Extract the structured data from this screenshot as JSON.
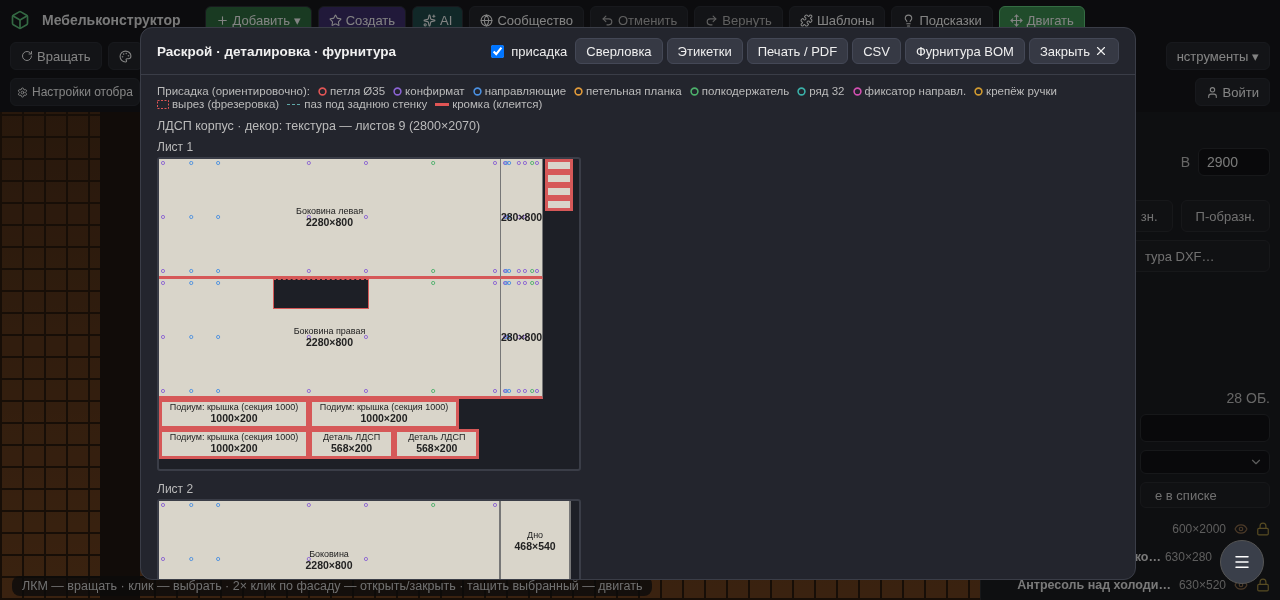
{
  "app": {
    "title": "Мебельконструктор",
    "toolbar": [
      {
        "label": "Добавить ▾",
        "kind": "green",
        "disabled": false,
        "selected": false
      },
      {
        "label": "Создать",
        "kind": "purple",
        "disabled": false,
        "selected": false
      },
      {
        "label": "AI",
        "kind": "teal",
        "disabled": false,
        "selected": false
      },
      {
        "label": "Сообщество",
        "kind": "plain",
        "disabled": false,
        "selected": false
      },
      {
        "label": "Отменить",
        "kind": "plain",
        "disabled": true,
        "selected": false
      },
      {
        "label": "Вернуть",
        "kind": "plain",
        "disabled": true,
        "selected": false
      },
      {
        "label": "Шаблоны",
        "kind": "plain",
        "disabled": false,
        "selected": false
      },
      {
        "label": "Подсказки",
        "kind": "plain",
        "disabled": false,
        "selected": false
      },
      {
        "label": "Двигать",
        "kind": "green",
        "disabled": false,
        "selected": true
      }
    ],
    "mode_button": {
      "label": "Вращать",
      "selected": false
    },
    "tools_menu": "нструменты ▾",
    "settings_button": "Настройки отобра",
    "login_button": "Войти",
    "side_panel": {
      "height_label": "В",
      "height_value": "2900",
      "shape_buttons": [
        "зн.",
        "П-образн."
      ],
      "export_button": "тура DXF…",
      "count": "28 ОБ.",
      "filter_hint": "е в списке",
      "items": [
        {
          "size": "600×2000"
        },
        {
          "name": "ко…",
          "size": "630×280"
        },
        {
          "name": "Антресоль над холоди…",
          "size": "630×520"
        }
      ]
    },
    "hint": "ЛКМ — вращать · клик — выбрать · 2× клик по фасаду — открыть/закрыть · тащить выбранный — двигать"
  },
  "dialog": {
    "title": "Раскрой · деталировка · фурнитура",
    "drilling_toggle": {
      "label": "присадка",
      "checked": true
    },
    "buttons": [
      {
        "label": "Сверловка",
        "kind": "plain"
      },
      {
        "label": "Этикетки",
        "kind": "plain"
      },
      {
        "label": "Печать / PDF",
        "kind": "plain"
      },
      {
        "label": "CSV",
        "kind": "plain"
      },
      {
        "label": "Фурнитура BOM",
        "kind": "plain"
      },
      {
        "label": "Закрыть",
        "kind": "close"
      }
    ],
    "legend": {
      "title": "Присадка (ориентировочно):",
      "items": [
        {
          "label": "петля Ø35",
          "kind": "hole",
          "color": "#e05555"
        },
        {
          "label": "конфирмат",
          "kind": "hole",
          "color": "#8a63d2"
        },
        {
          "label": "направляющие",
          "kind": "hole",
          "color": "#4a8fe0"
        },
        {
          "label": "петельная планка",
          "kind": "hole",
          "color": "#e09a3a"
        },
        {
          "label": "полкодержатель",
          "kind": "hole",
          "color": "#4caf6a"
        },
        {
          "label": "ряд 32",
          "kind": "hole",
          "color": "#3ab0a8"
        },
        {
          "label": "фиксатор направл.",
          "kind": "hole",
          "color": "#d04fb0"
        },
        {
          "label": "крепёж ручки",
          "kind": "hole",
          "color": "#d09a30"
        },
        {
          "label": "вырез (фрезеровка)",
          "kind": "cutout",
          "color": "#e05555"
        },
        {
          "label": "паз под заднюю стенку",
          "kind": "groove",
          "color": "#5fa8a8"
        },
        {
          "label": "кромка (клеится)",
          "kind": "edge",
          "color": "#e05555"
        }
      ]
    },
    "material": "ЛДСП корпус · декор: текстура — листов 9 (2800×2070)",
    "sheets": [
      {
        "title": "Лист 1",
        "parts": [
          {
            "name": "Боковина левая",
            "size": "2280×800",
            "kind": "side"
          },
          {
            "size": "280×800",
            "kind": "side"
          },
          {
            "kind": "banded"
          },
          {
            "kind": "banded"
          },
          {
            "kind": "banded"
          },
          {
            "kind": "banded"
          },
          {
            "name": "Боковина правая",
            "size": "2280×800",
            "kind": "notched"
          },
          {
            "size": "280×800",
            "kind": "side"
          },
          {
            "name": "Подиум: крышка (секция 1000)",
            "size": "1000×200",
            "kind": "banded"
          },
          {
            "name": "Подиум: крышка (секция 1000)",
            "size": "1000×200",
            "kind": "banded"
          },
          {
            "name": "Подиум: крышка (секция 1000)",
            "size": "1000×200",
            "kind": "banded"
          },
          {
            "name": "Деталь ЛДСП",
            "size": "568×200",
            "kind": "banded"
          },
          {
            "name": "Деталь ЛДСП",
            "size": "568×200",
            "kind": "banded"
          }
        ]
      },
      {
        "title": "Лист 2",
        "parts": [
          {
            "name": "Боковина",
            "size": "2280×800",
            "kind": "drilled"
          },
          {
            "name": "Дно",
            "size": "468×540",
            "kind": "plain"
          }
        ]
      }
    ]
  }
}
